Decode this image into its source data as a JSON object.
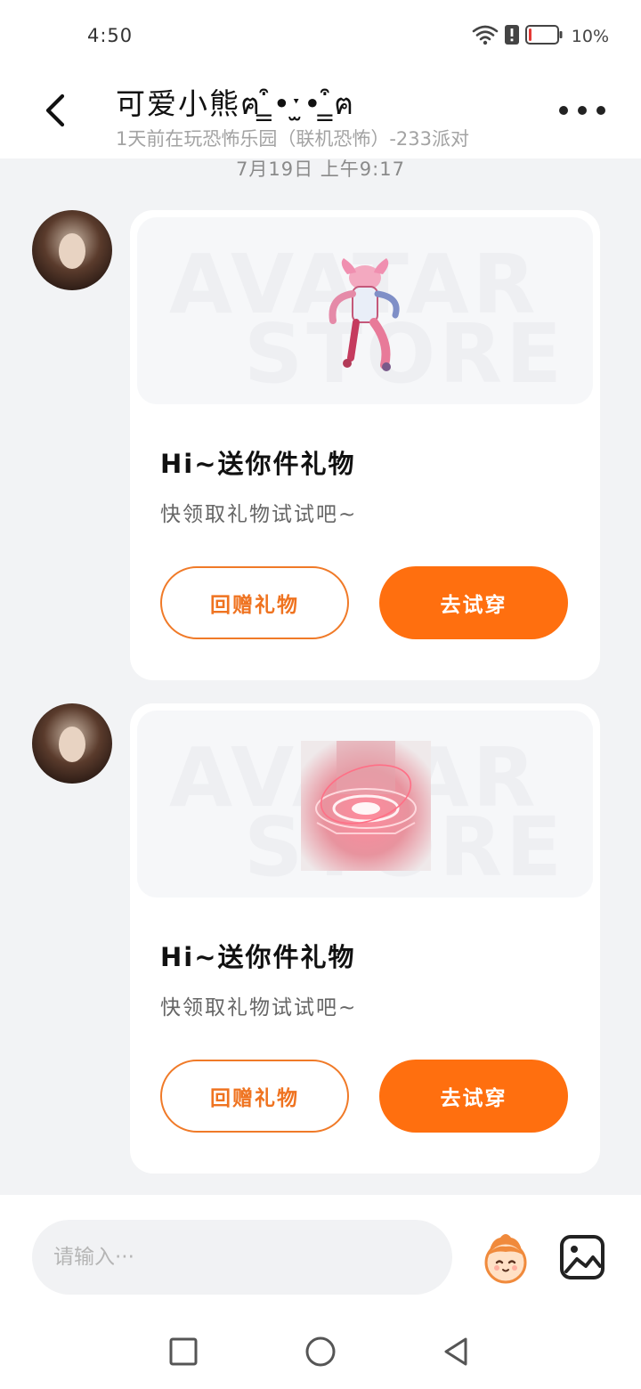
{
  "status_bar": {
    "time": "4:50",
    "battery_percent_label": "10%",
    "battery_level": 0.1,
    "icons": [
      "wifi-icon",
      "alert-icon",
      "battery-icon"
    ]
  },
  "header": {
    "title": "可爱小熊ฅ ̳͒•ˑ̫• ̳͒ฅ",
    "subtitle": "1天前在玩恐怖乐园（联机恐怖）-233派对",
    "back_icon": "chevron-left-icon",
    "more_icon": "more-dots-icon"
  },
  "timestamp": "7月19日 上午9:17",
  "messages": [
    {
      "sender_avatar": "avatar",
      "banner_watermark_top": "AVATAR",
      "banner_watermark_bottom": "STORE",
      "item_image": "pink-costume-figure",
      "title": "Hi~送你件礼物",
      "description": "快领取礼物试试吧~",
      "return_gift_label": "回赠礼物",
      "try_on_label": "去试穿"
    },
    {
      "sender_avatar": "avatar",
      "banner_watermark_top": "AVATAR",
      "banner_watermark_bottom": "STORE",
      "item_image": "red-glowing-portal-effect",
      "title": "Hi~送你件礼物",
      "description": "快领取礼物试试吧~",
      "return_gift_label": "回赠礼物",
      "try_on_label": "去试穿"
    }
  ],
  "input": {
    "placeholder": "请输入···",
    "value": "",
    "sticker_icon": "sticker-icon",
    "image_icon": "image-icon"
  },
  "nav": {
    "icons": [
      "recent-apps-icon",
      "home-icon",
      "back-icon"
    ]
  },
  "colors": {
    "accent": "#ff6f0f",
    "accent_outline": "#f07a28",
    "background": "#f2f3f5"
  }
}
